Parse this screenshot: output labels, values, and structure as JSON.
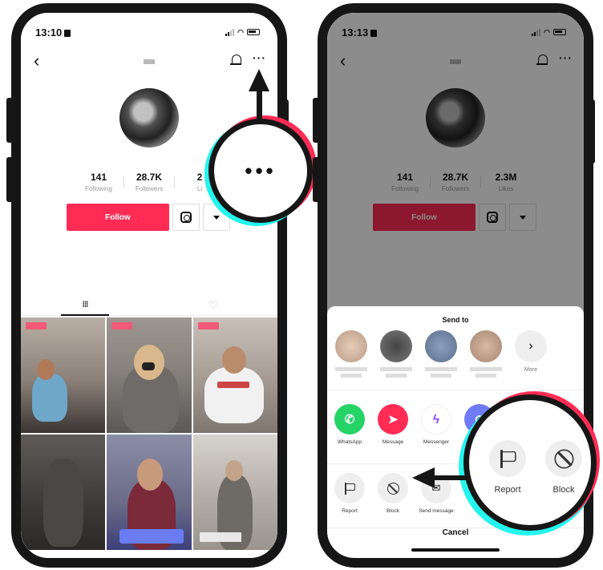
{
  "left_phone": {
    "status_time": "13:10",
    "stats": [
      {
        "value": "141",
        "label": "Following"
      },
      {
        "value": "28.7K",
        "label": "Followers"
      },
      {
        "value": "2",
        "label": "Li"
      }
    ],
    "follow_label": "Follow"
  },
  "right_phone": {
    "status_time": "13:13",
    "stats": [
      {
        "value": "141",
        "label": "Following"
      },
      {
        "value": "28.7K",
        "label": "Followers"
      },
      {
        "value": "2.3M",
        "label": "Likes"
      }
    ],
    "follow_label": "Follow",
    "sheet": {
      "title": "Send to",
      "more_label": "More",
      "apps": [
        {
          "label": "WhatsApp",
          "color": "#25d366",
          "icon": "whatsapp-icon"
        },
        {
          "label": "Message",
          "color": "#fe2c55",
          "icon": "message-icon"
        },
        {
          "label": "Messenger",
          "color": "#ffffff",
          "icon": "messenger-icon"
        },
        {
          "label": "",
          "color": "#6f7cf5",
          "icon": "link-icon"
        }
      ],
      "actions": [
        {
          "label": "Report",
          "icon": "flag-icon"
        },
        {
          "label": "Block",
          "icon": "block-icon"
        },
        {
          "label": "Send message",
          "icon": "send-message-icon"
        }
      ],
      "cancel_label": "Cancel"
    }
  },
  "magnifier_left": {
    "text": "•••"
  },
  "magnifier_right": {
    "report_label": "Report",
    "block_label": "Block"
  }
}
